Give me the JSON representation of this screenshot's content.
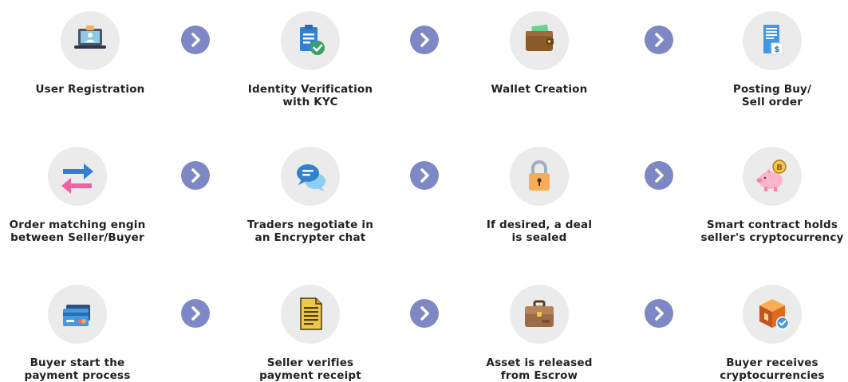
{
  "colors": {
    "icon_bg": "#ebebeb",
    "arrow_bg": "#7d88c5",
    "label_text": "#222222"
  },
  "rows": [
    {
      "steps": [
        {
          "label": "User Registration",
          "icon": "laptop-user-icon"
        },
        {
          "label": "Identity Verification\nwith KYC",
          "icon": "clipboard-check-icon"
        },
        {
          "label": "Wallet Creation",
          "icon": "wallet-icon"
        },
        {
          "label": "Posting Buy/\nSell order",
          "icon": "receipt-dollar-icon"
        }
      ]
    },
    {
      "steps": [
        {
          "label": "Order matching engin\nbetween Seller/Buyer",
          "icon": "exchange-arrows-icon"
        },
        {
          "label": "Traders negotiate in\nan Encrypter chat",
          "icon": "chat-bubbles-icon"
        },
        {
          "label": "If desired, a deal\nis sealed",
          "icon": "padlock-icon"
        },
        {
          "label": "Smart contract holds\nseller's cryptocurrency",
          "icon": "piggy-bank-coin-icon"
        }
      ]
    },
    {
      "steps": [
        {
          "label": "Buyer start the\npayment process",
          "icon": "credit-card-icon"
        },
        {
          "label": "Seller verifies\npayment receipt",
          "icon": "document-icon"
        },
        {
          "label": "Asset is released\nfrom Escrow",
          "icon": "briefcase-icon"
        },
        {
          "label": "Buyer receives\ncryptocurrencies",
          "icon": "package-check-icon"
        }
      ]
    }
  ]
}
